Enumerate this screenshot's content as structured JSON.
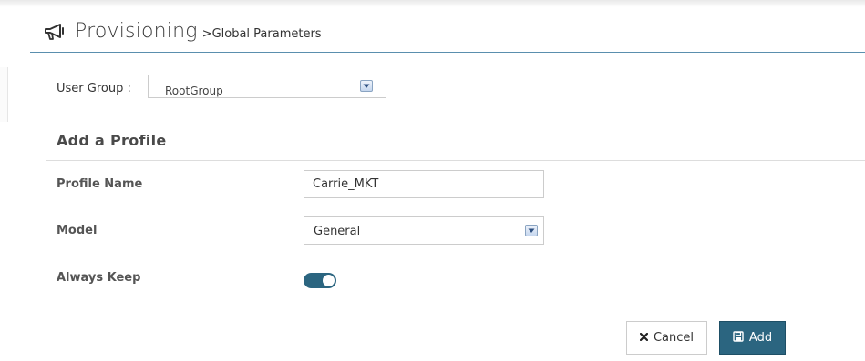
{
  "header": {
    "icon": "megaphone-icon",
    "title": "Provisioning",
    "subtitle": ">Global Parameters"
  },
  "user_group": {
    "label": "User Group :",
    "value": "RootGroup",
    "dropdown_icon": "chevron-down-icon"
  },
  "section": {
    "title": "Add a Profile"
  },
  "form": {
    "profile_name": {
      "label": "Profile Name",
      "value": "Carrie_MKT"
    },
    "model": {
      "label": "Model",
      "value": "General",
      "dropdown_icon": "chevron-down-icon"
    },
    "always_keep": {
      "label": "Always Keep",
      "enabled": true
    }
  },
  "actions": {
    "cancel": {
      "icon": "close-icon",
      "label": "Cancel"
    },
    "add": {
      "icon": "save-icon",
      "label": "Add"
    }
  },
  "colors": {
    "accent": "#2b6580",
    "title_rule": "#5a8fae"
  }
}
